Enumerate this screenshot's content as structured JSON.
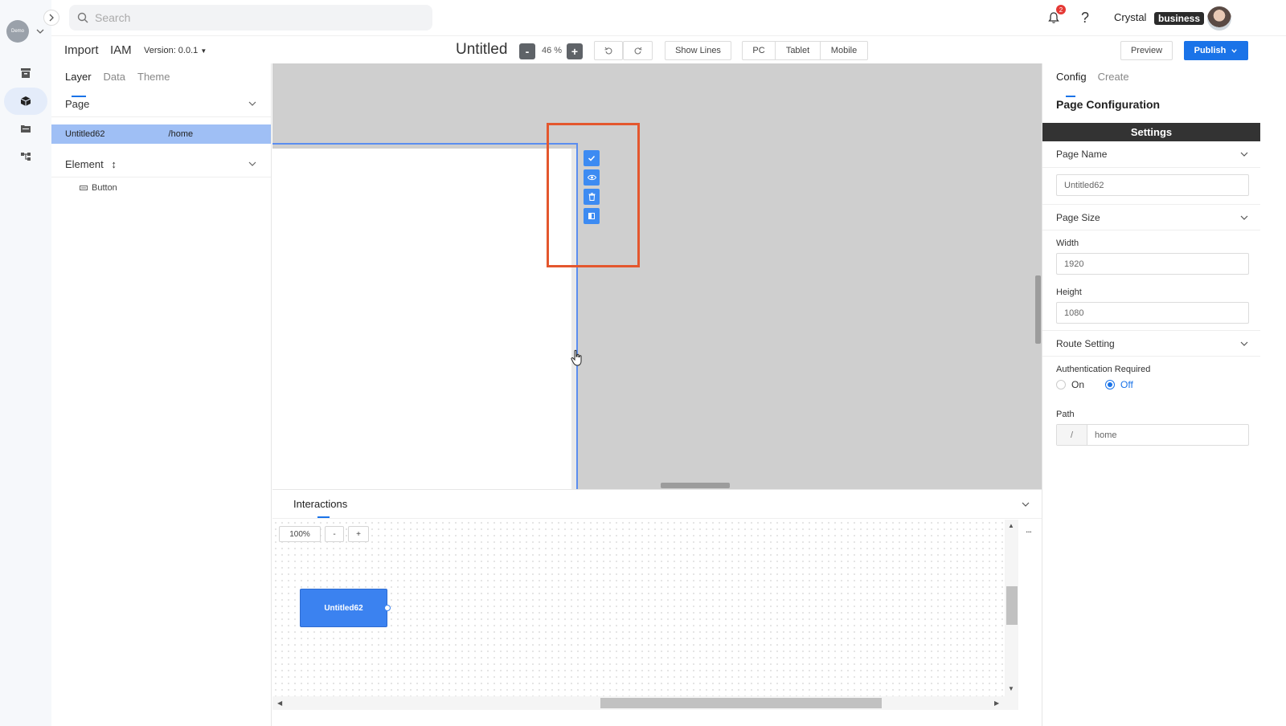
{
  "rail": {
    "logo_text": "Demo",
    "items": [
      {
        "icon": "archive-icon",
        "active": false
      },
      {
        "icon": "cube-icon",
        "active": true
      },
      {
        "icon": "folder-icon",
        "active": false
      },
      {
        "icon": "tree-icon",
        "active": false
      }
    ]
  },
  "header": {
    "search_placeholder": "Search",
    "notification_count": "2",
    "help_glyph": "?",
    "user_name": "Crystal",
    "plan_badge": "business"
  },
  "toolbar": {
    "import_label": "Import",
    "iam_label": "IAM",
    "version_label": "Version: 0.0.1",
    "doc_title": "Untitled",
    "zoom_out_label": "-",
    "zoom_value": "46 %",
    "zoom_in_label": "+",
    "show_lines_label": "Show Lines",
    "devices": [
      "PC",
      "Tablet",
      "Mobile"
    ],
    "preview_label": "Preview",
    "publish_label": "Publish"
  },
  "left_panel": {
    "tabs": [
      "Layer",
      "Data",
      "Theme"
    ],
    "page_section_label": "Page",
    "page_name": "Untitled62",
    "page_route": "/home",
    "element_section_label": "Element",
    "element_items": [
      "Button"
    ]
  },
  "interactions": {
    "title": "Interactions",
    "zoom_value": "100%",
    "zoom_out_label": "-",
    "zoom_in_label": "+",
    "node_label": "Untitled62",
    "more_label": "..."
  },
  "right_panel": {
    "tabs": [
      "Config",
      "Create"
    ],
    "title": "Page Configuration",
    "settings_label": "Settings",
    "page_name_section": "Page Name",
    "page_name_value": "Untitled62",
    "page_size_section": "Page Size",
    "width_label": "Width",
    "width_value": "1920",
    "height_label": "Height",
    "height_value": "1080",
    "route_section": "Route Setting",
    "auth_label": "Authentication Required",
    "auth_on_label": "On",
    "auth_off_label": "Off",
    "auth_selected": "Off",
    "path_label": "Path",
    "path_prefix": "/",
    "path_value": "home"
  },
  "colors": {
    "accent": "#1a73e8",
    "selected_row": "#9fbff5",
    "highlight_box": "#e4572e",
    "canvas_bg": "#cfcfcf",
    "badge_red": "#e53935"
  }
}
